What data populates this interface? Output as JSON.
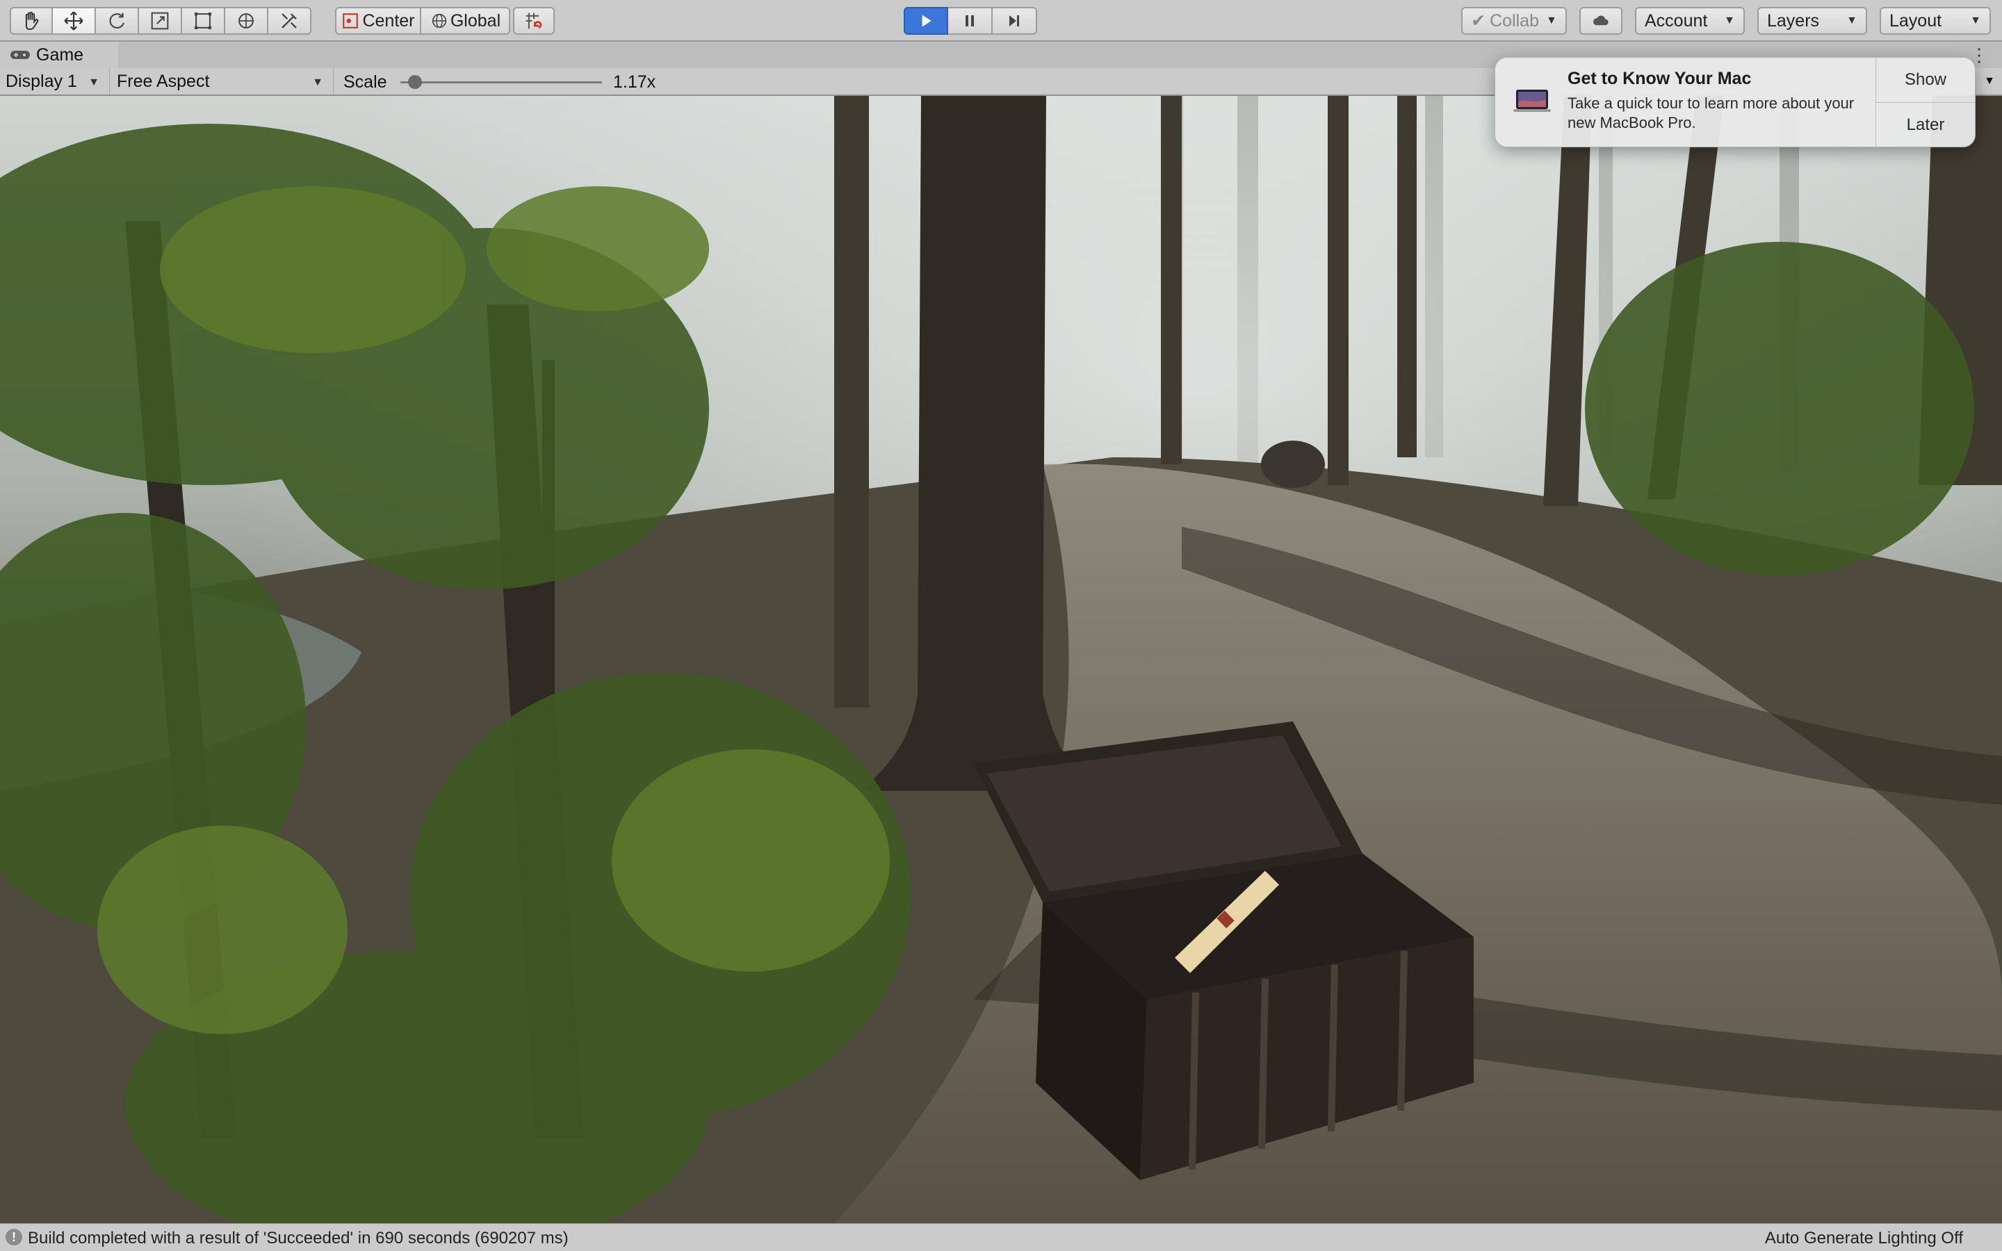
{
  "toolbar": {
    "tools": [
      {
        "name": "hand-tool",
        "icon": "hand-icon"
      },
      {
        "name": "move-tool",
        "icon": "move-arrows-icon"
      },
      {
        "name": "rotate-tool",
        "icon": "rotate-icon"
      },
      {
        "name": "scale-tool",
        "icon": "scale-icon"
      },
      {
        "name": "rect-tool",
        "icon": "rect-transform-icon"
      },
      {
        "name": "transform-tool",
        "icon": "transform-icon"
      },
      {
        "name": "custom-tool",
        "icon": "custom-editor-tool-icon"
      }
    ],
    "pivot_label": "Center",
    "space_label": "Global",
    "snap_icon": "grid-snap-icon",
    "collab_label": "Collab",
    "account_label": "Account",
    "layers_label": "Layers",
    "layout_label": "Layout",
    "play_color": "#3a77d8"
  },
  "tab": {
    "label": "Game",
    "icon": "gamepad-icon"
  },
  "game_controls": {
    "display": "Display 1",
    "aspect": "Free Aspect",
    "scale_label": "Scale",
    "scale_value": "1.17x",
    "scale_fraction": 0.04
  },
  "notification": {
    "title": "Get to Know Your Mac",
    "body": "Take a quick tour to learn more about your new MacBook Pro.",
    "show_label": "Show",
    "later_label": "Later"
  },
  "status": {
    "message": "Build completed with a result of 'Succeeded' in 690 seconds (690207 ms)",
    "right": "Auto Generate Lighting Off"
  }
}
